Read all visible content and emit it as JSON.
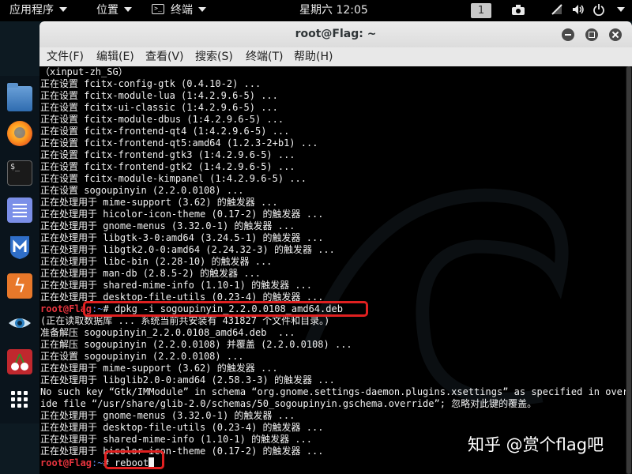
{
  "top_panel": {
    "applications": "应用程序",
    "places": "位置",
    "terminal": "终端",
    "clock": "星期六 12:05",
    "workspace": "1"
  },
  "dock": {
    "items": [
      {
        "name": "files-icon"
      },
      {
        "name": "firefox-icon"
      },
      {
        "name": "terminal-icon",
        "glyph": "$_"
      },
      {
        "name": "text-editor-icon"
      },
      {
        "name": "metasploit-icon"
      },
      {
        "name": "burpsuite-icon"
      },
      {
        "name": "eye-icon"
      },
      {
        "name": "cherrytree-icon"
      },
      {
        "name": "show-apps-icon"
      }
    ]
  },
  "window": {
    "title": "root@Flag: ~",
    "menu": [
      "文件(F)",
      "编辑(E)",
      "查看(V)",
      "搜索(S)",
      "终端(T)",
      "帮助(H)"
    ]
  },
  "terminal": {
    "prompt_user": "root@Flag",
    "prompt_path": ":~",
    "prompt_symbol": "# ",
    "lines_before": [
      "（xinput-zh_SG）",
      "正在设置 fcitx-config-gtk (0.4.10-2) ...",
      "正在设置 fcitx-module-lua (1:4.2.9.6-5) ...",
      "正在设置 fcitx-ui-classic (1:4.2.9.6-5) ...",
      "正在设置 fcitx-module-dbus (1:4.2.9.6-5) ...",
      "正在设置 fcitx-frontend-qt4 (1:4.2.9.6-5) ...",
      "正在设置 fcitx-frontend-qt5:amd64 (1.2.3-2+b1) ...",
      "正在设置 fcitx-frontend-gtk3 (1:4.2.9.6-5) ...",
      "正在设置 fcitx-frontend-gtk2 (1:4.2.9.6-5) ...",
      "正在设置 fcitx-module-kimpanel (1:4.2.9.6-5) ...",
      "正在设置 sogoupinyin (2.2.0.0108) ...",
      "正在处理用于 mime-support (3.62) 的触发器 ...",
      "正在处理用于 hicolor-icon-theme (0.17-2) 的触发器 ...",
      "正在处理用于 gnome-menus (3.32.0-1) 的触发器 ...",
      "正在处理用于 libgtk-3-0:amd64 (3.24.5-1) 的触发器 ...",
      "正在处理用于 libgtk2.0-0:amd64 (2.24.32-3) 的触发器 ...",
      "正在处理用于 libc-bin (2.28-10) 的触发器 ...",
      "正在处理用于 man-db (2.8.5-2) 的触发器 ...",
      "正在处理用于 shared-mime-info (1.10-1) 的触发器 ...",
      "正在处理用于 desktop-file-utils (0.23-4) 的触发器 ..."
    ],
    "command1": "dpkg -i sogoupinyin_2.2.0.0108_amd64.deb",
    "lines_after": [
      "(正在读取数据库 ... 系统当前共安装有 431827 个文件和目录。)",
      "准备解压 sogoupinyin_2.2.0.0108_amd64.deb  ...",
      "正在解压 sogoupinyin (2.2.0.0108) 并覆盖 (2.2.0.0108) ...",
      "正在设置 sogoupinyin (2.2.0.0108) ...",
      "正在处理用于 mime-support (3.62) 的触发器 ...",
      "正在处理用于 libglib2.0-0:amd64 (2.58.3-3) 的触发器 ...",
      "No such key “Gtk/IMModule” in schema “org.gnome.settings-daemon.plugins.xsettings” as specified in overr",
      "ide file “/usr/share/glib-2.0/schemas/50_sogoupinyin.gschema.override”; 忽略对此键的覆盖。",
      "正在处理用于 gnome-menus (3.32.0-1) 的触发器 ...",
      "正在处理用于 desktop-file-utils (0.23-4) 的触发器 ...",
      "正在处理用于 shared-mime-info (1.10-1) 的触发器 ...",
      "正在处理用于 hicolor-icon-theme (0.17-2) 的触发器 ..."
    ],
    "command2": "reboot"
  },
  "watermark": "知乎 @赏个flag吧",
  "colors": {
    "prompt_user": "#e8343e",
    "prompt_path": "#5d87e8",
    "highlight_box": "#e02020"
  }
}
